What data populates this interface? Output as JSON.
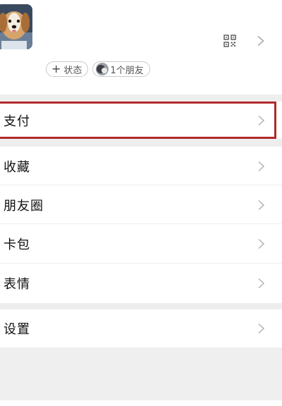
{
  "profile": {
    "status_chip": {
      "icon": "plus-icon",
      "label": "状态"
    },
    "friends_chip": {
      "label": "1个朋友"
    }
  },
  "menu": {
    "pay": {
      "label": "支付",
      "icon": "chevron-right-icon"
    },
    "favorites": {
      "label": "收藏",
      "icon": "chevron-right-icon"
    },
    "moments": {
      "label": "朋友圈",
      "icon": "chevron-right-icon"
    },
    "cards": {
      "label": "卡包",
      "icon": "chevron-right-icon"
    },
    "stickers": {
      "label": "表情",
      "icon": "chevron-right-icon"
    },
    "settings": {
      "label": "设置",
      "icon": "chevron-right-icon"
    }
  },
  "colors": {
    "highlight_border": "#b02a2a",
    "section_gap": "#eeeeee",
    "text": "#111111",
    "chevron": "#b3b3b3"
  }
}
